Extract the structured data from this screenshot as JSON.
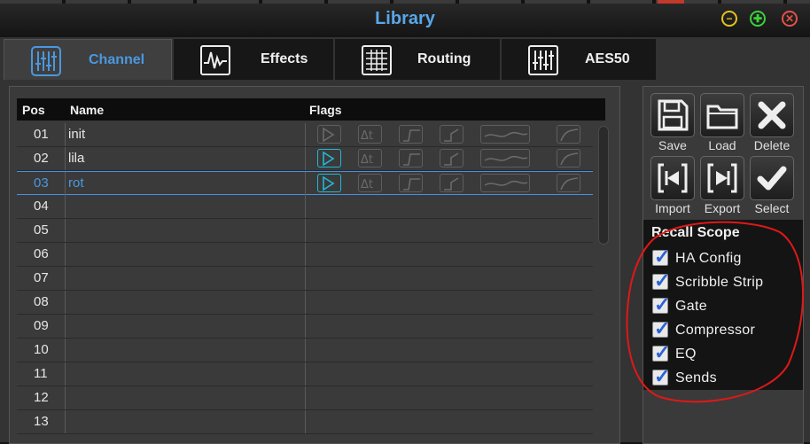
{
  "window": {
    "title": "Library"
  },
  "tabs": [
    {
      "label": "Channel",
      "icon": "channel-faders-icon",
      "active": true
    },
    {
      "label": "Effects",
      "icon": "effects-wave-icon",
      "active": false
    },
    {
      "label": "Routing",
      "icon": "routing-grid-icon",
      "active": false
    },
    {
      "label": "AES50",
      "icon": "aes50-faders-icon",
      "active": false
    }
  ],
  "list": {
    "headers": {
      "pos": "Pos",
      "name": "Name",
      "flags": "Flags"
    },
    "rows": [
      {
        "pos": "01",
        "name": "init",
        "flags_active": [
          false,
          false,
          false,
          false,
          false,
          false
        ]
      },
      {
        "pos": "02",
        "name": "lila",
        "flags_active": [
          true,
          false,
          false,
          false,
          false,
          false
        ]
      },
      {
        "pos": "03",
        "name": "rot",
        "flags_active": [
          true,
          false,
          false,
          false,
          false,
          false
        ],
        "selected": true
      },
      {
        "pos": "04",
        "name": ""
      },
      {
        "pos": "05",
        "name": ""
      },
      {
        "pos": "06",
        "name": ""
      },
      {
        "pos": "07",
        "name": ""
      },
      {
        "pos": "08",
        "name": ""
      },
      {
        "pos": "09",
        "name": ""
      },
      {
        "pos": "10",
        "name": ""
      },
      {
        "pos": "11",
        "name": ""
      },
      {
        "pos": "12",
        "name": ""
      },
      {
        "pos": "13",
        "name": ""
      }
    ],
    "flag_icons": [
      "play-icon",
      "delta-t-icon",
      "gate-curve-icon",
      "compressor-curve-icon",
      "eq-curve-icon",
      "dynamics-curve-icon"
    ]
  },
  "tools": {
    "save": "Save",
    "load": "Load",
    "delete": "Delete",
    "import": "Import",
    "export": "Export",
    "select": "Select"
  },
  "recall_scope": {
    "title": "Recall Scope",
    "items": [
      {
        "label": "HA Config",
        "checked": true
      },
      {
        "label": "Scribble Strip",
        "checked": true
      },
      {
        "label": "Gate",
        "checked": true
      },
      {
        "label": "Compressor",
        "checked": true
      },
      {
        "label": "EQ",
        "checked": true
      },
      {
        "label": "Sends",
        "checked": true
      }
    ]
  },
  "colors": {
    "accent_blue": "#4a98e0",
    "flag_active": "#22b8d8",
    "annotation_red": "#e01818",
    "minimize": "#e4c21c",
    "maximize": "#3bd13b",
    "close": "#e6504a"
  }
}
